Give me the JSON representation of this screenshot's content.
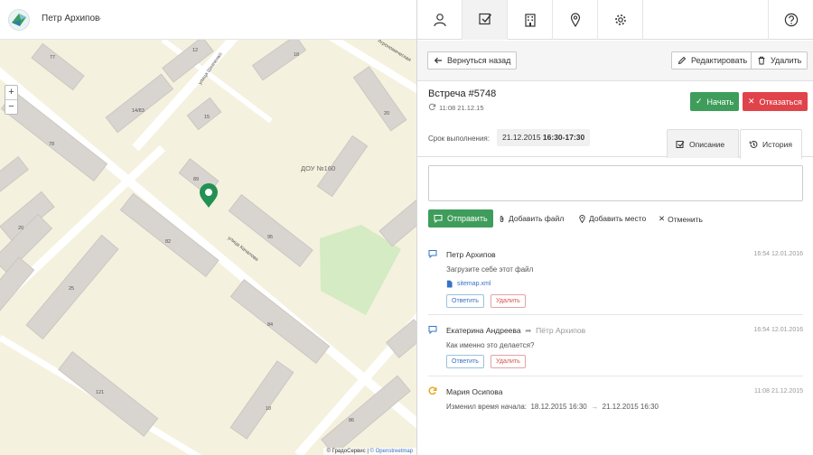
{
  "user": {
    "name": "Петр Архипов"
  },
  "map": {
    "zoom_in": "+",
    "zoom_out": "−",
    "attribution_prefix": "© ГрадоСервис | ",
    "attribution_link": "© Openstreetmap",
    "labels": {
      "street_shevchenko": "улица Шевченко",
      "street_kachalova": "улица Качалова",
      "street_agronomic": "Агрономическая",
      "dou": "ДОУ №160",
      "b77": "77",
      "b12": "12",
      "b18a": "18",
      "b1483": "14/83",
      "b15": "15",
      "b20a": "20",
      "b78": "78",
      "b89": "89",
      "b20b": "20",
      "b82": "82",
      "b95": "95",
      "b25": "25",
      "b84": "84",
      "b121": "121",
      "b18b": "18",
      "b86": "86"
    }
  },
  "toolbar": {
    "back": "Вернуться назад",
    "edit": "Редактировать",
    "delete": "Удалить"
  },
  "meeting": {
    "title": "Встреча #5748",
    "time": "11:08 21.12.15",
    "start": "Начать",
    "refuse": "Отказаться"
  },
  "deadline": {
    "label": "Срок выполнения:",
    "date": "21.12.2015",
    "interval": "16:30-17:30"
  },
  "tabs": {
    "description": "Описание",
    "history": "История"
  },
  "comment": {
    "send": "Отправить",
    "add_file": "Добавить файл",
    "add_place": "Добавить место",
    "cancel": "Отменить"
  },
  "history": [
    {
      "author": "Петр Архипов",
      "date": "16:54 12.01.2016",
      "text": "Загрузите себе этот файл",
      "file": "sitemap.xml",
      "reply": "Ответить",
      "delete": "Удалить"
    },
    {
      "author": "Екатерина Андреева",
      "recipient": "Пётр Архипов",
      "date": "16:54 12.01.2016",
      "text": "Как именно это делается?",
      "reply": "Ответить",
      "delete": "Удалить"
    },
    {
      "author": "Мария Осипова",
      "date": "11:08 21.12.2015",
      "text_prefix": "Изменил время начала:",
      "from": "18.12.2015 16:30",
      "to": "21.12.2015 16:30"
    }
  ],
  "colors": {
    "accent_green": "#3f9d5b",
    "danger_red": "#e0434a",
    "link_blue": "#3673c5",
    "marker_green": "#239054"
  }
}
